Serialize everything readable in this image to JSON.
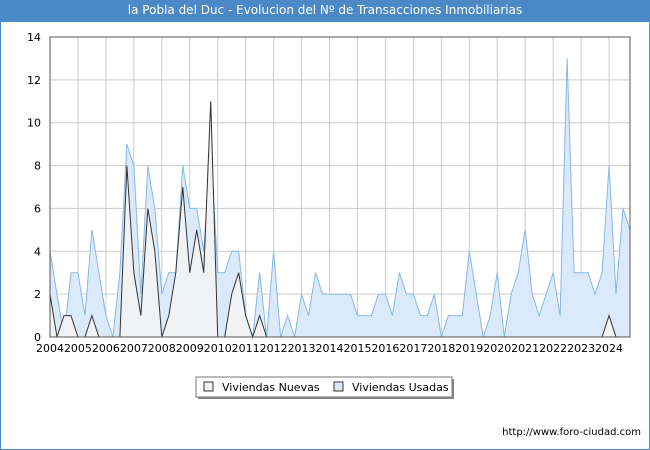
{
  "header": {
    "title": "la Pobla del Duc - Evolucion del Nº de Transacciones Inmobiliarias"
  },
  "footer": {
    "url": "http://www.foro-ciudad.com"
  },
  "colors": {
    "accent": "#4a88c6",
    "usadas_fill": "#dbeafb",
    "usadas_line": "#86b8e8",
    "nuevas_fill": "#f2f2f2",
    "nuevas_line": "#333333",
    "grid": "#cccccc"
  },
  "chart_data": {
    "type": "area",
    "title": "la Pobla del Duc - Evolucion del Nº de Transacciones Inmobiliarias",
    "xlabel": "",
    "ylabel": "",
    "x_range": [
      2004,
      2024.75
    ],
    "ylim": [
      0,
      14
    ],
    "y_ticks": [
      "0",
      "2",
      "4",
      "6",
      "8",
      "10",
      "12",
      "14"
    ],
    "x_tick_labels": [
      "2004",
      "2005",
      "2006",
      "2007",
      "2008",
      "2009",
      "2010",
      "2011",
      "2012",
      "2013",
      "2014",
      "2015",
      "2016",
      "2017",
      "2018",
      "2019",
      "2020",
      "2021",
      "2022",
      "2023",
      "2024"
    ],
    "grid": true,
    "legend_position": "bottom-center",
    "series": [
      {
        "name": "Viviendas Usadas",
        "x": [
          2004,
          2004.25,
          2004.5,
          2004.75,
          2005,
          2005.25,
          2005.5,
          2005.75,
          2006,
          2006.25,
          2006.5,
          2006.75,
          2007,
          2007.25,
          2007.5,
          2007.75,
          2008,
          2008.25,
          2008.5,
          2008.75,
          2009,
          2009.25,
          2009.5,
          2009.75,
          2010,
          2010.25,
          2010.5,
          2010.75,
          2011,
          2011.25,
          2011.5,
          2011.75,
          2012,
          2012.25,
          2012.5,
          2012.75,
          2013,
          2013.25,
          2013.5,
          2013.75,
          2014,
          2014.25,
          2014.5,
          2014.75,
          2015,
          2015.25,
          2015.5,
          2015.75,
          2016,
          2016.25,
          2016.5,
          2016.75,
          2017,
          2017.25,
          2017.5,
          2017.75,
          2018,
          2018.25,
          2018.5,
          2018.75,
          2019,
          2019.25,
          2019.5,
          2019.75,
          2020,
          2020.25,
          2020.5,
          2020.75,
          2021,
          2021.25,
          2021.5,
          2021.75,
          2022,
          2022.25,
          2022.5,
          2022.75,
          2023,
          2023.25,
          2023.5,
          2023.75,
          2024,
          2024.25,
          2024.5,
          2024.75
        ],
        "values": [
          4,
          2,
          0,
          3,
          3,
          1,
          5,
          3,
          1,
          0,
          3,
          9,
          8,
          2,
          8,
          6,
          2,
          3,
          3,
          8,
          6,
          6,
          4,
          9,
          3,
          3,
          4,
          4,
          1,
          0,
          3,
          0,
          4,
          0,
          1,
          0,
          2,
          1,
          3,
          2,
          2,
          2,
          2,
          2,
          1,
          1,
          1,
          2,
          2,
          1,
          3,
          2,
          2,
          1,
          1,
          2,
          0,
          1,
          1,
          1,
          4,
          2,
          0,
          1,
          3,
          0,
          2,
          3,
          5,
          2,
          1,
          2,
          3,
          1,
          13,
          3,
          3,
          3,
          2,
          3,
          8,
          2,
          6,
          5
        ]
      },
      {
        "name": "Viviendas Nuevas",
        "x": [
          2004,
          2004.25,
          2004.5,
          2004.75,
          2005,
          2005.25,
          2005.5,
          2005.75,
          2006,
          2006.25,
          2006.5,
          2006.75,
          2007,
          2007.25,
          2007.5,
          2007.75,
          2008,
          2008.25,
          2008.5,
          2008.75,
          2009,
          2009.25,
          2009.5,
          2009.75,
          2010,
          2010.25,
          2010.5,
          2010.75,
          2011,
          2011.25,
          2011.5,
          2011.75,
          2012,
          2012.25,
          2012.5,
          2012.75,
          2013,
          2013.25,
          2013.5,
          2013.75,
          2014,
          2014.25,
          2014.5,
          2014.75,
          2015,
          2015.25,
          2015.5,
          2015.75,
          2016,
          2016.25,
          2016.5,
          2016.75,
          2017,
          2017.25,
          2017.5,
          2017.75,
          2018,
          2018.25,
          2018.5,
          2018.75,
          2019,
          2019.25,
          2019.5,
          2019.75,
          2020,
          2020.25,
          2020.5,
          2020.75,
          2021,
          2021.25,
          2021.5,
          2021.75,
          2022,
          2022.25,
          2022.5,
          2022.75,
          2023,
          2023.25,
          2023.5,
          2023.75,
          2024,
          2024.25,
          2024.5,
          2024.75
        ],
        "values": [
          2,
          0,
          1,
          1,
          0,
          0,
          1,
          0,
          0,
          0,
          0,
          8,
          3,
          1,
          6,
          4,
          0,
          1,
          3,
          7,
          3,
          5,
          3,
          11,
          0,
          0,
          2,
          3,
          1,
          0,
          1,
          0,
          0,
          0,
          0,
          0,
          0,
          0,
          0,
          0,
          0,
          0,
          0,
          0,
          0,
          0,
          0,
          0,
          0,
          0,
          0,
          0,
          0,
          0,
          0,
          0,
          0,
          0,
          0,
          0,
          0,
          0,
          0,
          0,
          0,
          0,
          0,
          0,
          0,
          0,
          0,
          0,
          0,
          0,
          0,
          0,
          0,
          0,
          0,
          0,
          1,
          0,
          0,
          0
        ]
      }
    ]
  }
}
